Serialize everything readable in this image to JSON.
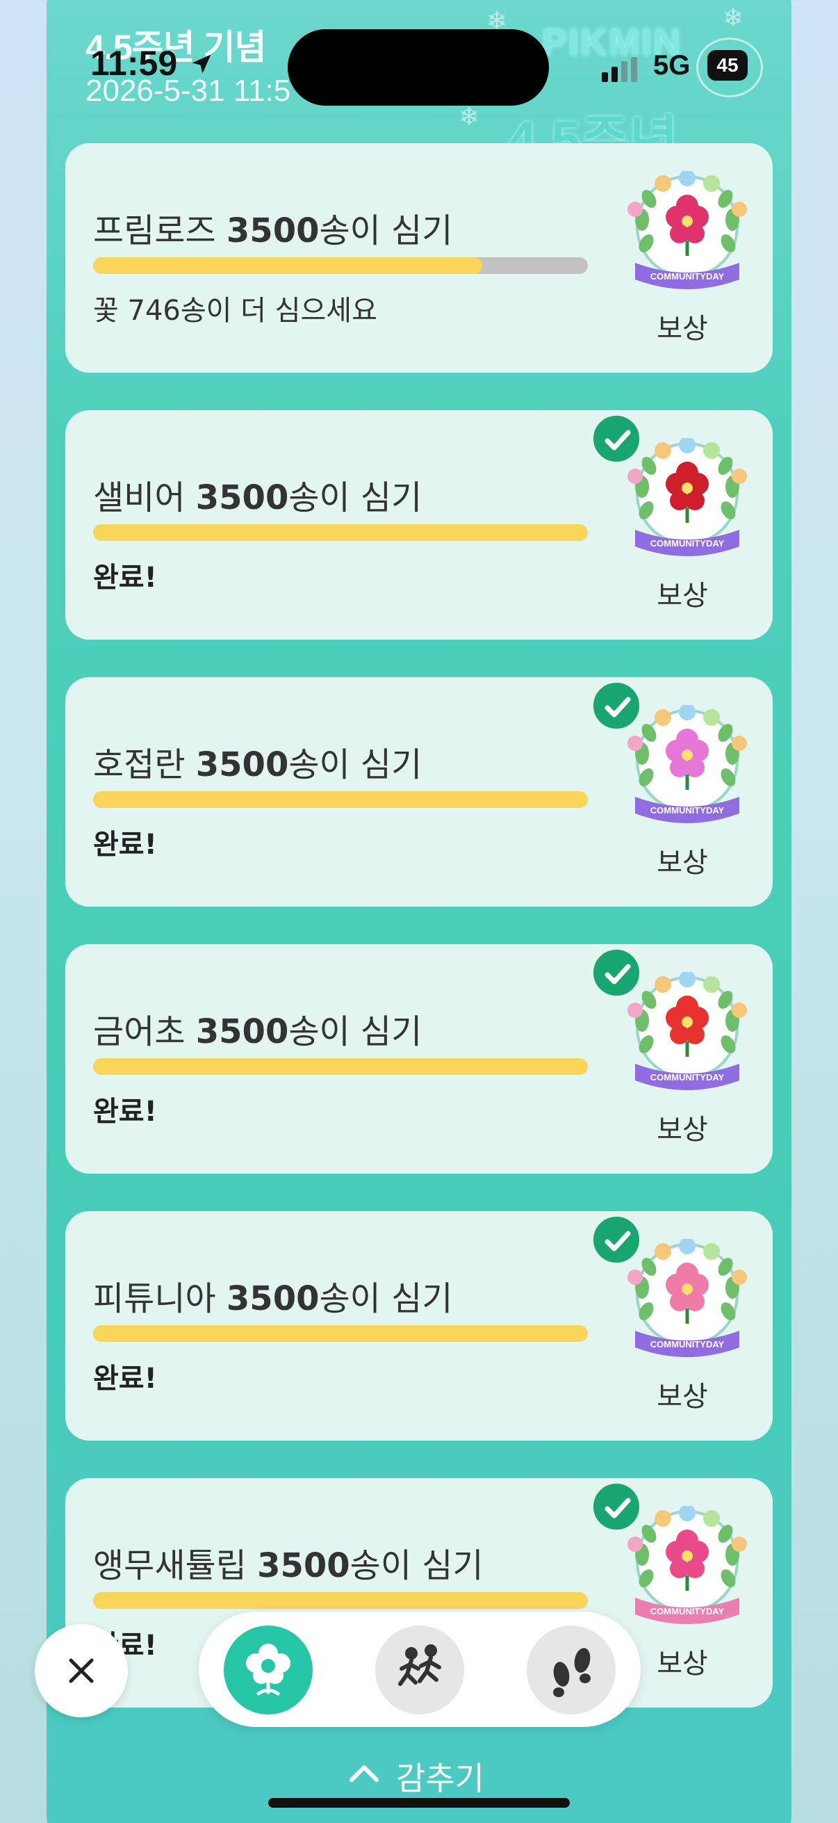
{
  "hero": {
    "title": "4.5주년 기념",
    "date": "2026-5-31 11:5",
    "logo_line1": "PIKMIN",
    "logo_line2": "4.5주년"
  },
  "status_bar": {
    "time": "11:59",
    "network": "5G",
    "battery": "45"
  },
  "cards": [
    {
      "name": "프림로즈",
      "goal": "3500",
      "suffix": "송이 심기",
      "progress": 0.787,
      "status": "꽃 746송이 더 심으세요",
      "completed": false,
      "reward_label": "보상",
      "flower_color": "#e0336e",
      "frame_color": "#8f6de0"
    },
    {
      "name": "샐비어",
      "goal": "3500",
      "suffix": "송이 심기",
      "progress": 1.0,
      "status": "완료!",
      "completed": true,
      "reward_label": "보상",
      "flower_color": "#d01f2c",
      "frame_color": "#8f6de0"
    },
    {
      "name": "호접란",
      "goal": "3500",
      "suffix": "송이 심기",
      "progress": 1.0,
      "status": "완료!",
      "completed": true,
      "reward_label": "보상",
      "flower_color": "#e676d8",
      "frame_color": "#8f6de0"
    },
    {
      "name": "금어초",
      "goal": "3500",
      "suffix": "송이 심기",
      "progress": 1.0,
      "status": "완료!",
      "completed": true,
      "reward_label": "보상",
      "flower_color": "#e83232",
      "frame_color": "#8f6de0"
    },
    {
      "name": "피튜니아",
      "goal": "3500",
      "suffix": "송이 심기",
      "progress": 1.0,
      "status": "완료!",
      "completed": true,
      "reward_label": "보상",
      "flower_color": "#f07aa8",
      "frame_color": "#8f6de0"
    },
    {
      "name": "앵무새튤립",
      "goal": "3500",
      "suffix": "송이 심기",
      "progress": 1.0,
      "status": "완료!",
      "completed": true,
      "reward_label": "보상",
      "flower_color": "#e84a8a",
      "frame_color": "#e87fb0"
    }
  ],
  "badge_text": "COMMUNITYDAY",
  "bottom": {
    "close_icon": "close-icon",
    "nav": [
      {
        "icon": "flower-icon",
        "active": true
      },
      {
        "icon": "running-people-icon",
        "active": false
      },
      {
        "icon": "footprints-icon",
        "active": false
      }
    ],
    "hide_label": "감추기"
  },
  "colors": {
    "accent": "#26c6a6",
    "check": "#18a56f",
    "progress_fill": "#f9d65a",
    "progress_track": "#c2c2c2",
    "card_bg": "#e3f5f1"
  }
}
